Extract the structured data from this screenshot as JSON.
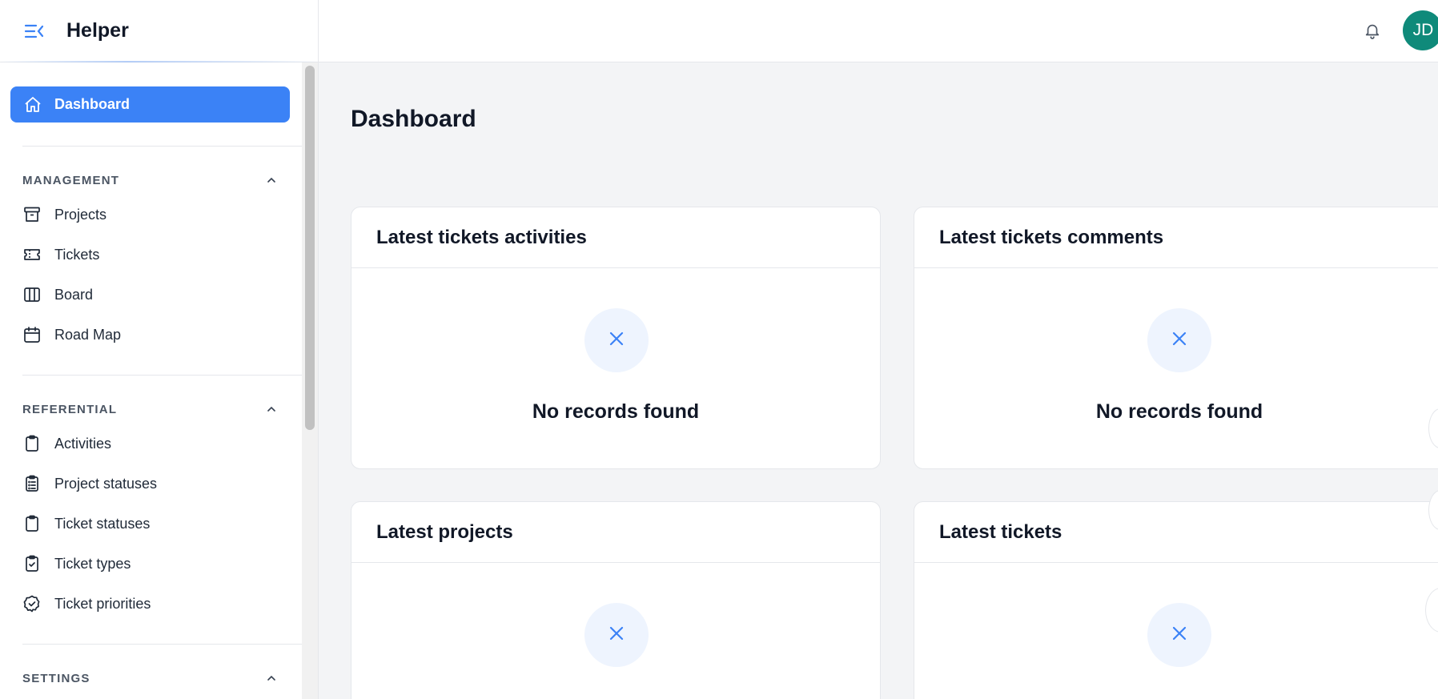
{
  "app": {
    "title": "Helper",
    "menu_icon": "menu-collapse-icon",
    "notification_icon": "bell-icon",
    "user_initials": "JD",
    "colors": {
      "accent": "#3b82f6",
      "avatar_bg": "#0f8a7a",
      "empty_icon_bg": "#eef4fe"
    }
  },
  "sidebar": {
    "active": {
      "label": "Dashboard",
      "icon": "home-icon"
    },
    "groups": [
      {
        "title": "MANAGEMENT",
        "items": [
          {
            "label": "Projects",
            "icon": "archive-icon"
          },
          {
            "label": "Tickets",
            "icon": "ticket-icon"
          },
          {
            "label": "Board",
            "icon": "columns-icon"
          },
          {
            "label": "Road Map",
            "icon": "calendar-icon"
          }
        ]
      },
      {
        "title": "REFERENTIAL",
        "items": [
          {
            "label": "Activities",
            "icon": "clipboard-icon"
          },
          {
            "label": "Project statuses",
            "icon": "clipboard-list-icon"
          },
          {
            "label": "Ticket statuses",
            "icon": "clipboard-icon"
          },
          {
            "label": "Ticket types",
            "icon": "clipboard-check-icon"
          },
          {
            "label": "Ticket priorities",
            "icon": "badge-check-icon"
          }
        ]
      },
      {
        "title": "SETTINGS",
        "items": []
      }
    ]
  },
  "main": {
    "title": "Dashboard",
    "widgets": [
      {
        "title": "Latest tickets activities",
        "empty_text": "No records found"
      },
      {
        "title": "Latest tickets comments",
        "empty_text": "No records found"
      },
      {
        "title": "Latest projects",
        "empty_text": ""
      },
      {
        "title": "Latest tickets",
        "empty_text": ""
      }
    ]
  }
}
